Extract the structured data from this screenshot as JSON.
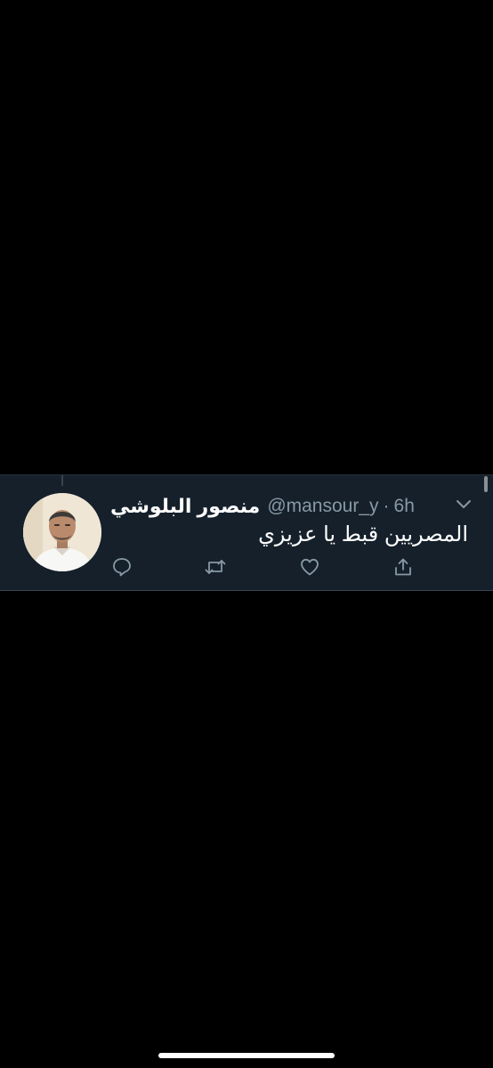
{
  "tweet": {
    "display_name": "منصور البلوشي",
    "handle": "@mansour_y",
    "separator": "·",
    "time": "6h",
    "text": "المصريين قبط يا عزيزي",
    "avatar_icon": "profile-photo",
    "caret_icon": "chevron-down-icon",
    "actions": {
      "reply_icon": "reply-icon",
      "retweet_icon": "retweet-icon",
      "like_icon": "heart-icon",
      "share_icon": "share-icon"
    }
  },
  "colors": {
    "background": "#000000",
    "card_background": "#15202b",
    "primary_text": "#ffffff",
    "secondary_text": "#8899a6",
    "border": "#38444d"
  }
}
